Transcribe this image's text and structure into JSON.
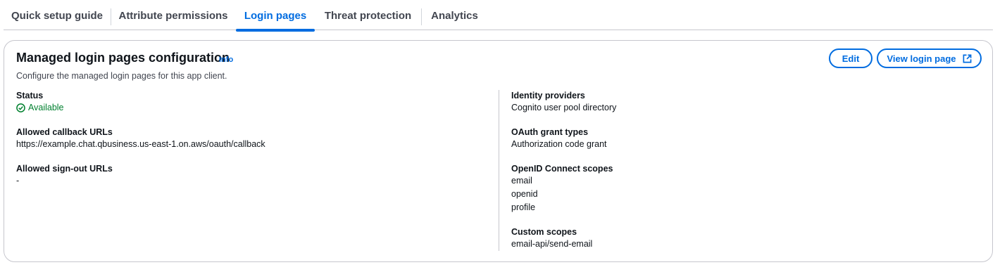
{
  "tabs": [
    {
      "label": "Quick setup guide"
    },
    {
      "label": "Attribute permissions"
    },
    {
      "label": "Login pages"
    },
    {
      "label": "Threat protection"
    },
    {
      "label": "Analytics"
    }
  ],
  "active_tab": "Login pages",
  "section": {
    "title": "Managed login pages configuration",
    "info_label": "Info",
    "description": "Configure the managed login pages for this app client.",
    "edit_label": "Edit",
    "view_label": "View login page"
  },
  "left": {
    "status_label": "Status",
    "status_value": "Available",
    "callback_label": "Allowed callback URLs",
    "callback_value": "https://example.chat.qbusiness.us-east-1.on.aws/oauth/callback",
    "signout_label": "Allowed sign-out URLs",
    "signout_value": "-"
  },
  "right": {
    "idp_label": "Identity providers",
    "idp_value": "Cognito user pool directory",
    "grant_label": "OAuth grant types",
    "grant_value": "Authorization code grant",
    "oidc_label": "OpenID Connect scopes",
    "oidc_values": [
      "email",
      "openid",
      "profile"
    ],
    "custom_label": "Custom scopes",
    "custom_value": "email-api/send-email"
  },
  "colors": {
    "accent": "#006ce0",
    "success": "#00802f",
    "border": "#c6c6cd"
  }
}
